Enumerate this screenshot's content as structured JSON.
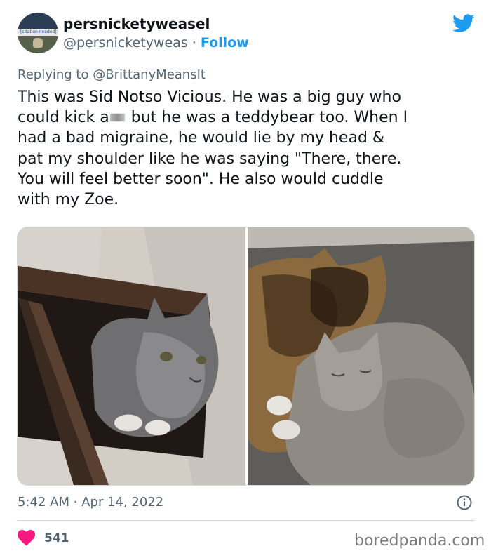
{
  "author": {
    "display_name": "persnicketyweasel",
    "handle": "@persnicketyweas",
    "separator": "·",
    "follow_label": "Follow",
    "avatar_text": "[citation needed]"
  },
  "reply": {
    "prefix": "Replying to",
    "mention": "@BrittanyMeansIt"
  },
  "tweet": {
    "lines": [
      {
        "before": "This was Sid Notso  Vicious. He was a big guy who"
      },
      {
        "before": "could kick a",
        "censored": true,
        "after": " but he was a teddybear too. When I"
      },
      {
        "before": "had a bad migraine, he would lie by my head &"
      },
      {
        "before": "pat my shoulder like he was saying \"There, there."
      },
      {
        "before": "You will feel better soon\". He also would cuddle"
      },
      {
        "before": "with my Zoe."
      }
    ]
  },
  "footer": {
    "time": "5:42 AM",
    "separator": "·",
    "date": "Apr 14, 2022",
    "likes": "541"
  },
  "watermark": "boredpanda.com",
  "colors": {
    "accent": "#1d9bf0",
    "heart": "#f91880",
    "muted": "#536471"
  },
  "icons": [
    "twitter-bird-icon",
    "info-icon",
    "heart-icon"
  ]
}
